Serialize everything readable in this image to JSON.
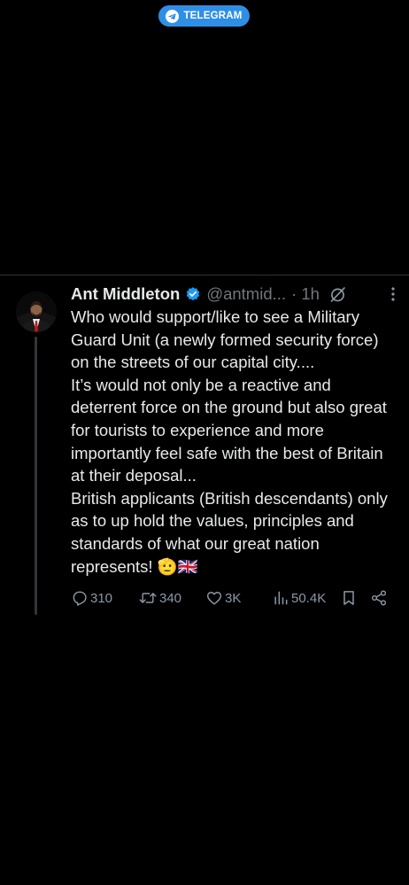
{
  "banner": {
    "label": "TELEGRAM",
    "color": "#2f8fe6",
    "icon": "telegram-plane-icon"
  },
  "tweet": {
    "author_name": "Ant Middleton",
    "handle": "@antmid...",
    "time": "· 1h",
    "verified_icon": "verified-badge-icon",
    "text": "Who would support/like to see a Military Guard Unit (a newly formed security force) on the streets of our capital city....\nIt’s would not only be a reactive and deterrent force on the ground but also great for tourists to experience and more importantly feel safe with the best of Britain at their deposal...\nBritish applicants (British descendants) only as to up hold the values, principles and standards of what our great nation represents! 🫡🇬🇧",
    "accent_color": "#1d9bf0"
  },
  "actions": {
    "replies": "310",
    "reposts": "340",
    "likes": "3K",
    "views": "50.4K"
  }
}
